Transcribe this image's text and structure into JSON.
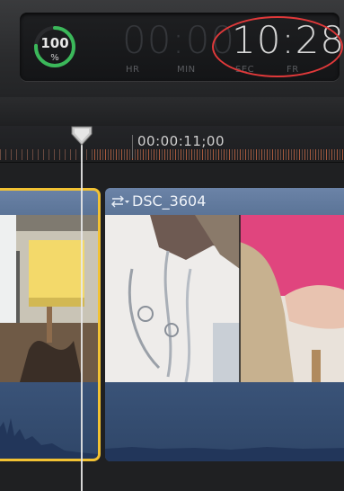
{
  "dashboard": {
    "meter_value": "100",
    "meter_unit": "%",
    "timecode_dim": "00:00",
    "timecode_lit": "10:28",
    "labels": {
      "hr": "HR",
      "min": "MIN",
      "sec": "SEC",
      "fr": "FR"
    },
    "meter_level": 1.0,
    "annotation_color": "#e0393a"
  },
  "ruler": {
    "timecode": "00:00:11;00"
  },
  "timeline": {
    "clip_b_title": "DSC_3604",
    "selection_color": "#f2c233",
    "clip_color": "#4b6486"
  },
  "icons": {
    "meter": "progress-ring-icon",
    "clip_menu": "clip-options-icon",
    "playhead": "playhead-icon"
  }
}
